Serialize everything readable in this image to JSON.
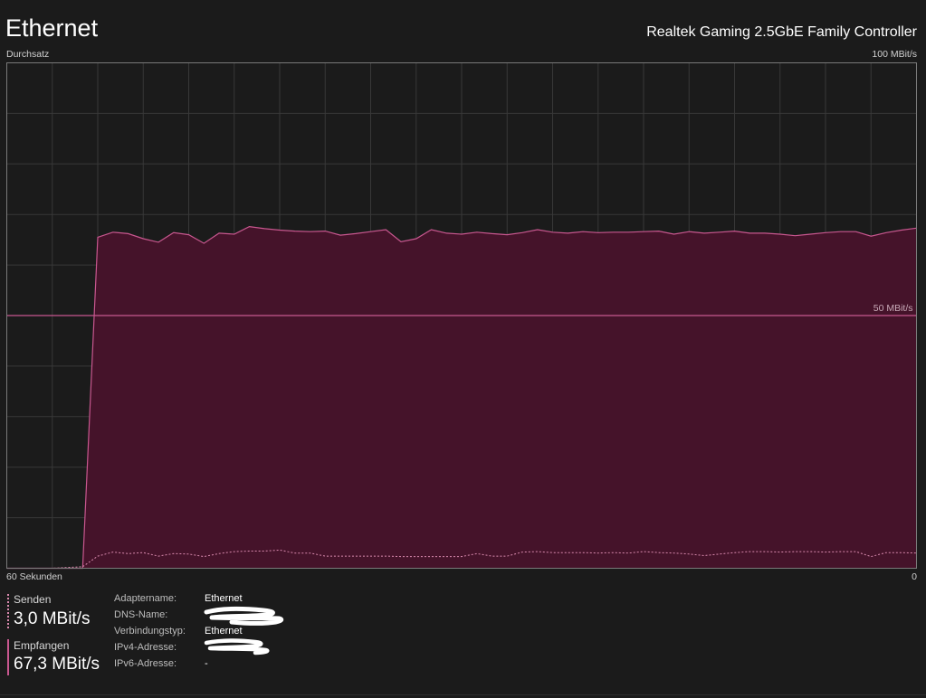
{
  "header": {
    "title": "Ethernet",
    "device": "Realtek Gaming 2.5GbE Family Controller"
  },
  "graph": {
    "top_left_label": "Durchsatz",
    "top_right_label": "100 MBit/s",
    "scale_label": "50 MBit/s",
    "bottom_left_label": "60 Sekunden",
    "bottom_right_label": "0"
  },
  "colors": {
    "background": "#1b1b1b",
    "grid": "#383838",
    "border": "#7a7a7a",
    "accent_line": "#c8578f",
    "receive_fill": "#45132a",
    "send_line": "#d98aae"
  },
  "legend": {
    "send": {
      "label": "Senden",
      "value": "3,0 MBit/s"
    },
    "receive": {
      "label": "Empfangen",
      "value": "67,3 MBit/s"
    }
  },
  "properties": [
    {
      "key": "Adaptername:",
      "value": "Ethernet"
    },
    {
      "key": "DNS-Name:",
      "value": ""
    },
    {
      "key": "Verbindungstyp:",
      "value": "Ethernet"
    },
    {
      "key": "IPv4-Adresse:",
      "value": ""
    },
    {
      "key": "IPv6-Adresse:",
      "value": "-"
    }
  ],
  "chart_data": {
    "type": "area",
    "title": "Durchsatz",
    "xlabel": "60 Sekunden",
    "ylabel": "",
    "xlim": [
      60,
      0
    ],
    "ylim": [
      0,
      100
    ],
    "y_unit": "MBit/s",
    "grid": true,
    "x": [
      60,
      57,
      55,
      54,
      53,
      52,
      51,
      50,
      49,
      48,
      47,
      46,
      45,
      44,
      43,
      42,
      41,
      40,
      39,
      38,
      37,
      36,
      35,
      34,
      33,
      32,
      31,
      30,
      29,
      28,
      27,
      26,
      25,
      24,
      23,
      22,
      21,
      20,
      19,
      18,
      17,
      16,
      15,
      14,
      13,
      12,
      11,
      10,
      9,
      8,
      7,
      6,
      5,
      4,
      3,
      2,
      1,
      0
    ],
    "series": [
      {
        "name": "Empfangen",
        "values": [
          0,
          0,
          0,
          65.5,
          66.5,
          66.2,
          65.2,
          64.5,
          66.4,
          66.0,
          64.3,
          66.3,
          66.1,
          67.6,
          67.2,
          66.9,
          66.7,
          66.6,
          66.7,
          65.9,
          66.2,
          66.6,
          67.0,
          64.6,
          65.2,
          67.0,
          66.3,
          66.1,
          66.5,
          66.2,
          66.0,
          66.4,
          67.0,
          66.5,
          66.3,
          66.6,
          66.4,
          66.5,
          66.5,
          66.6,
          66.7,
          66.1,
          66.6,
          66.3,
          66.5,
          66.7,
          66.3,
          66.3,
          66.1,
          65.8,
          66.1,
          66.4,
          66.6,
          66.6,
          65.7,
          66.4,
          66.9,
          67.3
        ]
      },
      {
        "name": "Senden",
        "values": [
          0,
          0,
          0.3,
          2.4,
          3.2,
          2.9,
          3.1,
          2.4,
          2.9,
          2.8,
          2.3,
          2.9,
          3.3,
          3.4,
          3.4,
          3.6,
          3.0,
          3.0,
          2.4,
          2.4,
          2.4,
          2.4,
          2.4,
          2.3,
          2.3,
          2.3,
          2.3,
          2.3,
          2.9,
          2.4,
          2.4,
          3.2,
          3.3,
          3.1,
          3.1,
          3.1,
          3.0,
          3.1,
          3.0,
          3.3,
          3.1,
          3.0,
          2.8,
          2.5,
          2.8,
          3.1,
          3.3,
          3.3,
          3.2,
          3.3,
          3.3,
          3.2,
          3.3,
          3.3,
          2.3,
          3.1,
          3.1,
          3.0
        ]
      }
    ],
    "annotations": [
      "100 MBit/s",
      "50 MBit/s"
    ]
  }
}
